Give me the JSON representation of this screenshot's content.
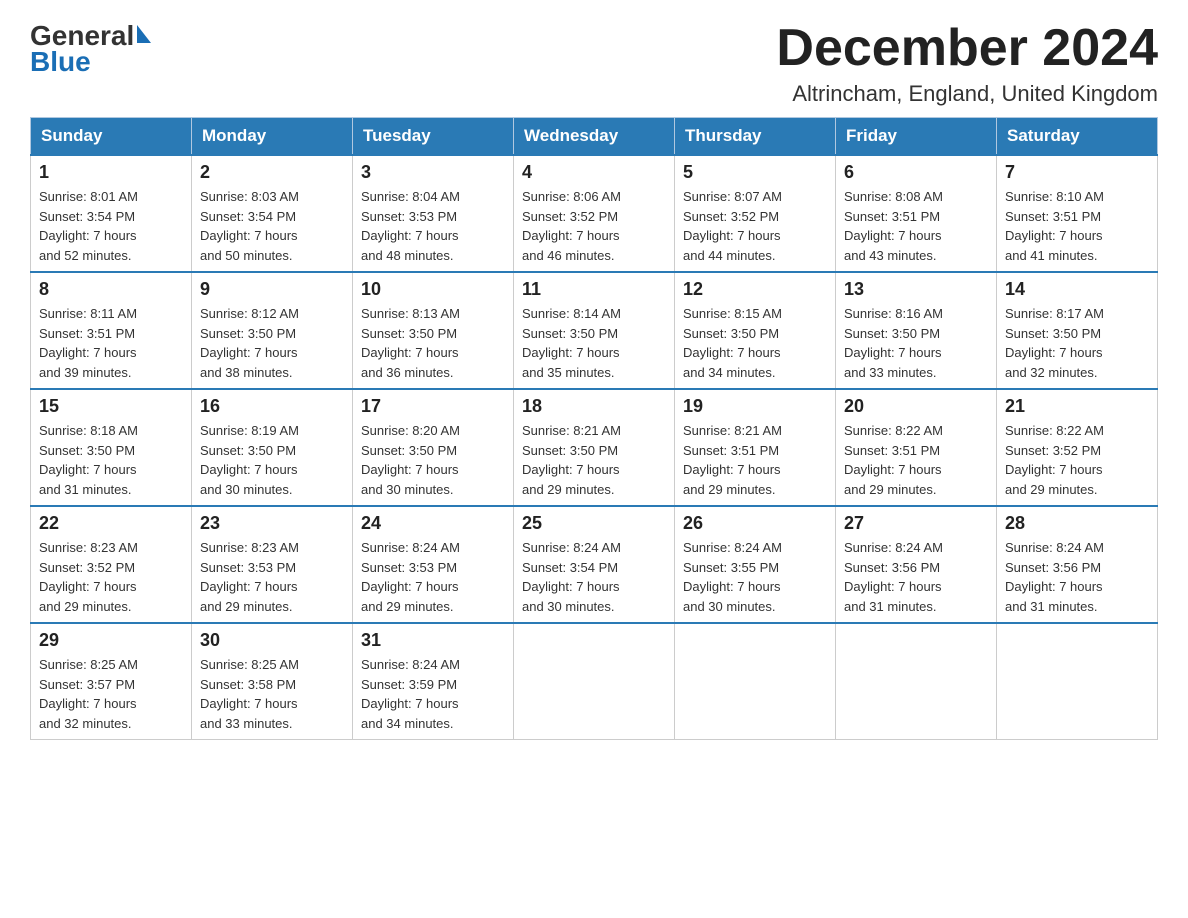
{
  "header": {
    "logo_general": "General",
    "logo_blue": "Blue",
    "month_title": "December 2024",
    "location": "Altrincham, England, United Kingdom"
  },
  "days_of_week": [
    "Sunday",
    "Monday",
    "Tuesday",
    "Wednesday",
    "Thursday",
    "Friday",
    "Saturday"
  ],
  "weeks": [
    [
      {
        "day": "1",
        "sunrise": "Sunrise: 8:01 AM",
        "sunset": "Sunset: 3:54 PM",
        "daylight": "Daylight: 7 hours",
        "minutes": "and 52 minutes."
      },
      {
        "day": "2",
        "sunrise": "Sunrise: 8:03 AM",
        "sunset": "Sunset: 3:54 PM",
        "daylight": "Daylight: 7 hours",
        "minutes": "and 50 minutes."
      },
      {
        "day": "3",
        "sunrise": "Sunrise: 8:04 AM",
        "sunset": "Sunset: 3:53 PM",
        "daylight": "Daylight: 7 hours",
        "minutes": "and 48 minutes."
      },
      {
        "day": "4",
        "sunrise": "Sunrise: 8:06 AM",
        "sunset": "Sunset: 3:52 PM",
        "daylight": "Daylight: 7 hours",
        "minutes": "and 46 minutes."
      },
      {
        "day": "5",
        "sunrise": "Sunrise: 8:07 AM",
        "sunset": "Sunset: 3:52 PM",
        "daylight": "Daylight: 7 hours",
        "minutes": "and 44 minutes."
      },
      {
        "day": "6",
        "sunrise": "Sunrise: 8:08 AM",
        "sunset": "Sunset: 3:51 PM",
        "daylight": "Daylight: 7 hours",
        "minutes": "and 43 minutes."
      },
      {
        "day": "7",
        "sunrise": "Sunrise: 8:10 AM",
        "sunset": "Sunset: 3:51 PM",
        "daylight": "Daylight: 7 hours",
        "minutes": "and 41 minutes."
      }
    ],
    [
      {
        "day": "8",
        "sunrise": "Sunrise: 8:11 AM",
        "sunset": "Sunset: 3:51 PM",
        "daylight": "Daylight: 7 hours",
        "minutes": "and 39 minutes."
      },
      {
        "day": "9",
        "sunrise": "Sunrise: 8:12 AM",
        "sunset": "Sunset: 3:50 PM",
        "daylight": "Daylight: 7 hours",
        "minutes": "and 38 minutes."
      },
      {
        "day": "10",
        "sunrise": "Sunrise: 8:13 AM",
        "sunset": "Sunset: 3:50 PM",
        "daylight": "Daylight: 7 hours",
        "minutes": "and 36 minutes."
      },
      {
        "day": "11",
        "sunrise": "Sunrise: 8:14 AM",
        "sunset": "Sunset: 3:50 PM",
        "daylight": "Daylight: 7 hours",
        "minutes": "and 35 minutes."
      },
      {
        "day": "12",
        "sunrise": "Sunrise: 8:15 AM",
        "sunset": "Sunset: 3:50 PM",
        "daylight": "Daylight: 7 hours",
        "minutes": "and 34 minutes."
      },
      {
        "day": "13",
        "sunrise": "Sunrise: 8:16 AM",
        "sunset": "Sunset: 3:50 PM",
        "daylight": "Daylight: 7 hours",
        "minutes": "and 33 minutes."
      },
      {
        "day": "14",
        "sunrise": "Sunrise: 8:17 AM",
        "sunset": "Sunset: 3:50 PM",
        "daylight": "Daylight: 7 hours",
        "minutes": "and 32 minutes."
      }
    ],
    [
      {
        "day": "15",
        "sunrise": "Sunrise: 8:18 AM",
        "sunset": "Sunset: 3:50 PM",
        "daylight": "Daylight: 7 hours",
        "minutes": "and 31 minutes."
      },
      {
        "day": "16",
        "sunrise": "Sunrise: 8:19 AM",
        "sunset": "Sunset: 3:50 PM",
        "daylight": "Daylight: 7 hours",
        "minutes": "and 30 minutes."
      },
      {
        "day": "17",
        "sunrise": "Sunrise: 8:20 AM",
        "sunset": "Sunset: 3:50 PM",
        "daylight": "Daylight: 7 hours",
        "minutes": "and 30 minutes."
      },
      {
        "day": "18",
        "sunrise": "Sunrise: 8:21 AM",
        "sunset": "Sunset: 3:50 PM",
        "daylight": "Daylight: 7 hours",
        "minutes": "and 29 minutes."
      },
      {
        "day": "19",
        "sunrise": "Sunrise: 8:21 AM",
        "sunset": "Sunset: 3:51 PM",
        "daylight": "Daylight: 7 hours",
        "minutes": "and 29 minutes."
      },
      {
        "day": "20",
        "sunrise": "Sunrise: 8:22 AM",
        "sunset": "Sunset: 3:51 PM",
        "daylight": "Daylight: 7 hours",
        "minutes": "and 29 minutes."
      },
      {
        "day": "21",
        "sunrise": "Sunrise: 8:22 AM",
        "sunset": "Sunset: 3:52 PM",
        "daylight": "Daylight: 7 hours",
        "minutes": "and 29 minutes."
      }
    ],
    [
      {
        "day": "22",
        "sunrise": "Sunrise: 8:23 AM",
        "sunset": "Sunset: 3:52 PM",
        "daylight": "Daylight: 7 hours",
        "minutes": "and 29 minutes."
      },
      {
        "day": "23",
        "sunrise": "Sunrise: 8:23 AM",
        "sunset": "Sunset: 3:53 PM",
        "daylight": "Daylight: 7 hours",
        "minutes": "and 29 minutes."
      },
      {
        "day": "24",
        "sunrise": "Sunrise: 8:24 AM",
        "sunset": "Sunset: 3:53 PM",
        "daylight": "Daylight: 7 hours",
        "minutes": "and 29 minutes."
      },
      {
        "day": "25",
        "sunrise": "Sunrise: 8:24 AM",
        "sunset": "Sunset: 3:54 PM",
        "daylight": "Daylight: 7 hours",
        "minutes": "and 30 minutes."
      },
      {
        "day": "26",
        "sunrise": "Sunrise: 8:24 AM",
        "sunset": "Sunset: 3:55 PM",
        "daylight": "Daylight: 7 hours",
        "minutes": "and 30 minutes."
      },
      {
        "day": "27",
        "sunrise": "Sunrise: 8:24 AM",
        "sunset": "Sunset: 3:56 PM",
        "daylight": "Daylight: 7 hours",
        "minutes": "and 31 minutes."
      },
      {
        "day": "28",
        "sunrise": "Sunrise: 8:24 AM",
        "sunset": "Sunset: 3:56 PM",
        "daylight": "Daylight: 7 hours",
        "minutes": "and 31 minutes."
      }
    ],
    [
      {
        "day": "29",
        "sunrise": "Sunrise: 8:25 AM",
        "sunset": "Sunset: 3:57 PM",
        "daylight": "Daylight: 7 hours",
        "minutes": "and 32 minutes."
      },
      {
        "day": "30",
        "sunrise": "Sunrise: 8:25 AM",
        "sunset": "Sunset: 3:58 PM",
        "daylight": "Daylight: 7 hours",
        "minutes": "and 33 minutes."
      },
      {
        "day": "31",
        "sunrise": "Sunrise: 8:24 AM",
        "sunset": "Sunset: 3:59 PM",
        "daylight": "Daylight: 7 hours",
        "minutes": "and 34 minutes."
      },
      null,
      null,
      null,
      null
    ]
  ]
}
